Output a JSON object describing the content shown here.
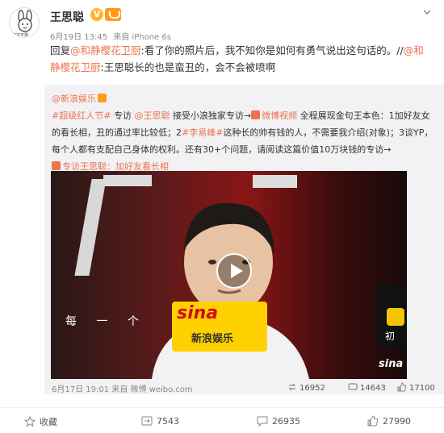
{
  "header": {
    "avatar_caption": "宝宝不哭",
    "user_name": "王思聪",
    "verified_badge": "V",
    "post_time": "6月19日 13:45",
    "post_source": "来自 iPhone 6s"
  },
  "post": {
    "reply_prefix": "回复",
    "mention1": "@和静樱花卫厨",
    "reply_text1": ":看了你的照片后，我不知你是如何有勇气说出这句话的。",
    "sep": "//",
    "mention2": "@和静樱花卫厨",
    "reply_text2": ":王思聪长的也是蛮丑的，会不会被喷啊"
  },
  "repost": {
    "author": "@新浪娱乐",
    "tag": "#超级红人节#",
    "special": "专访",
    "mention": "@王思聪",
    "text1": "接受小浪独家专访→",
    "video_link": "微博视频",
    "text2": "全程展现金句王本色：1加好友女的看长相，丑的通过率比较低；2",
    "tag2": "#李易峰#",
    "text3": "这种长的帅有钱的人，不需要我介绍(对象)；3谈YP，每个人都有支配自己身体的权利。还有30+个问题，请阅读这篇价值10万块钱的专访→",
    "link_label": "专访王思聪：加好友看长相",
    "video": {
      "caption": "每 一 个",
      "logo_text": "sina",
      "logo_sub": "新浪娱乐",
      "corner_logo": "sina",
      "side_text": "初"
    },
    "footer": {
      "time": "6月17日 19:01",
      "source": "来自 微博 weibo.com",
      "reposts": "16952",
      "comments": "14643",
      "likes": "17100"
    }
  },
  "actions": {
    "favorite": "收藏",
    "repost": "7543",
    "comment": "26935",
    "like": "27990"
  },
  "colors": {
    "mention": "#eb7350",
    "badge": "#ffb42a",
    "repost_bg": "#f2f2f5"
  }
}
